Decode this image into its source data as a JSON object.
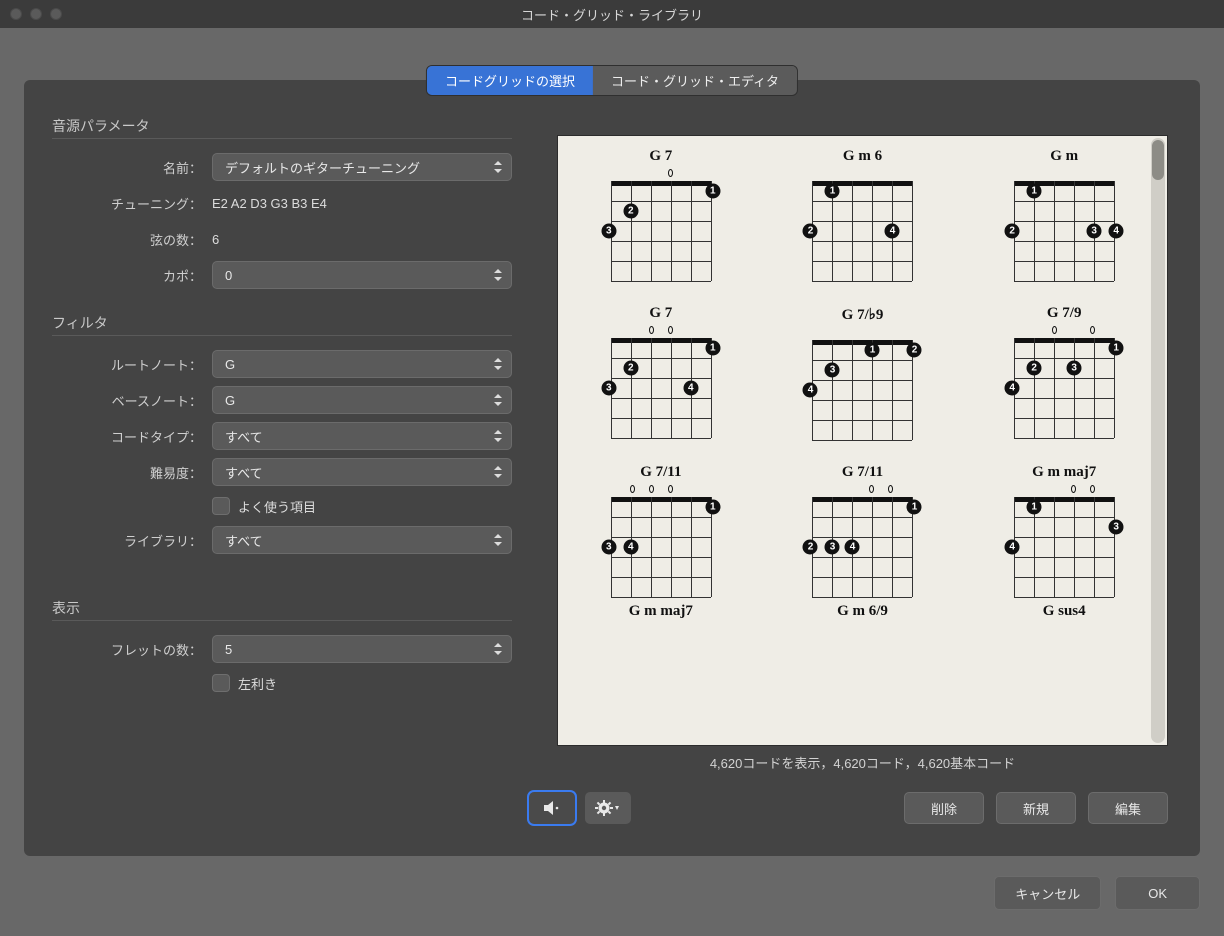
{
  "window": {
    "title": "コード・グリッド・ライブラリ"
  },
  "tabs": {
    "select": "コードグリッドの選択",
    "editor": "コード・グリッド・エディタ"
  },
  "sections": {
    "params": "音源パラメータ",
    "filter": "フィルタ",
    "display": "表示"
  },
  "labels": {
    "name": "名前：",
    "tuning": "チューニング：",
    "strings": "弦の数：",
    "capo": "カポ：",
    "root": "ルートノート：",
    "bass": "ベースノート：",
    "chordType": "コードタイプ：",
    "difficulty": "難易度：",
    "favorites": "よく使う項目",
    "library": "ライブラリ：",
    "frets": "フレットの数：",
    "lefty": "左利き"
  },
  "values": {
    "name": "デフォルトのギターチューニング",
    "tuning": "E2 A2 D3 G3 B3 E4",
    "strings": "6",
    "capo": "0",
    "root": "G",
    "bass": "G",
    "chordType": "すべて",
    "difficulty": "すべて",
    "library": "すべて",
    "frets": "5"
  },
  "status": "4,620コードを表示，4,620コード，4,620基本コード",
  "buttons": {
    "delete": "削除",
    "new": "新規",
    "edit": "編集",
    "cancel": "キャンセル",
    "ok": "OK"
  },
  "chords": [
    {
      "name": "G 7",
      "open": [
        0,
        0,
        0,
        1,
        0,
        0
      ],
      "dots": [
        {
          "s": 0,
          "f": 3,
          "n": "3"
        },
        {
          "s": 1,
          "f": 2,
          "n": "2"
        },
        {
          "s": 5,
          "f": 1,
          "n": "1"
        }
      ]
    },
    {
      "name": "G m 6",
      "open": [
        0,
        0,
        0,
        0,
        0,
        0
      ],
      "dots": [
        {
          "s": 1,
          "f": 1,
          "n": "1"
        },
        {
          "s": 0,
          "f": 3,
          "n": "2"
        },
        {
          "s": 4,
          "f": 3,
          "n": "4"
        }
      ]
    },
    {
      "name": "G m",
      "open": [
        0,
        0,
        0,
        0,
        0,
        0
      ],
      "dots": [
        {
          "s": 1,
          "f": 1,
          "n": "1"
        },
        {
          "s": 0,
          "f": 3,
          "n": "2"
        },
        {
          "s": 4,
          "f": 3,
          "n": "3"
        },
        {
          "s": 5,
          "f": 3,
          "n": "4"
        }
      ]
    },
    {
      "name": "G 7",
      "open": [
        0,
        0,
        1,
        1,
        0,
        0
      ],
      "dots": [
        {
          "s": 1,
          "f": 2,
          "n": "2"
        },
        {
          "s": 0,
          "f": 3,
          "n": "3"
        },
        {
          "s": 4,
          "f": 3,
          "n": "4"
        },
        {
          "s": 5,
          "f": 1,
          "n": "1"
        }
      ]
    },
    {
      "name": "G 7/♭9",
      "open": [
        0,
        0,
        0,
        0,
        0,
        0
      ],
      "dots": [
        {
          "s": 3,
          "f": 1,
          "n": "1"
        },
        {
          "s": 5,
          "f": 1,
          "n": "2"
        },
        {
          "s": 1,
          "f": 2,
          "n": "3"
        },
        {
          "s": 0,
          "f": 3,
          "n": "4"
        }
      ]
    },
    {
      "name": "G 7/9",
      "open": [
        0,
        0,
        1,
        0,
        1,
        0
      ],
      "dots": [
        {
          "s": 1,
          "f": 2,
          "n": "2"
        },
        {
          "s": 3,
          "f": 2,
          "n": "3"
        },
        {
          "s": 0,
          "f": 3,
          "n": "4"
        },
        {
          "s": 5,
          "f": 1,
          "n": "1"
        }
      ]
    },
    {
      "name": "G 7/11",
      "open": [
        0,
        1,
        1,
        1,
        0,
        0
      ],
      "dots": [
        {
          "s": 5,
          "f": 1,
          "n": "1"
        },
        {
          "s": 0,
          "f": 3,
          "n": "3"
        },
        {
          "s": 1,
          "f": 3,
          "n": "4"
        }
      ]
    },
    {
      "name": "G 7/11",
      "open": [
        0,
        0,
        0,
        1,
        1,
        0
      ],
      "dots": [
        {
          "s": 5,
          "f": 1,
          "n": "1"
        },
        {
          "s": 0,
          "f": 3,
          "n": "2"
        },
        {
          "s": 1,
          "f": 3,
          "n": "3"
        },
        {
          "s": 2,
          "f": 3,
          "n": "4"
        }
      ]
    },
    {
      "name": "G m maj7",
      "open": [
        0,
        0,
        0,
        1,
        1,
        0
      ],
      "dots": [
        {
          "s": 1,
          "f": 1,
          "n": "1"
        },
        {
          "s": 5,
          "f": 2,
          "n": "3"
        },
        {
          "s": 0,
          "f": 3,
          "n": "4"
        }
      ]
    }
  ],
  "partial": [
    "G m maj7",
    "G m 6/9",
    "G sus4"
  ]
}
